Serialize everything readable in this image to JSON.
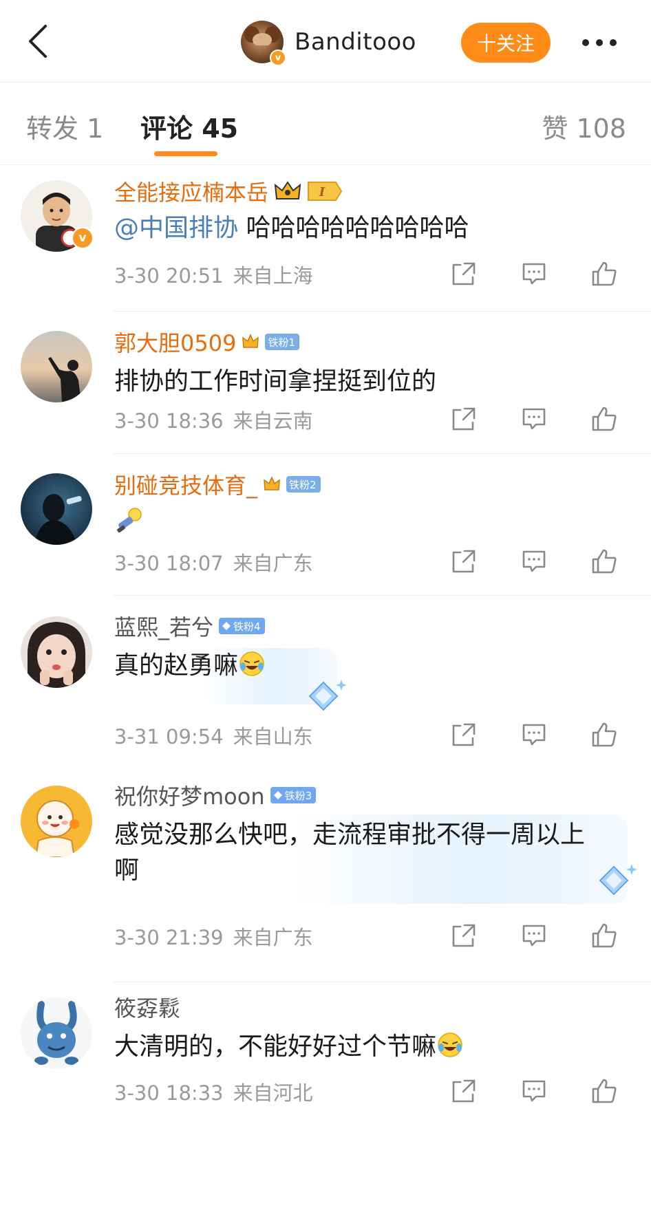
{
  "header": {
    "username": "Banditooo",
    "follow_label": "十关注",
    "verified_mark": "v"
  },
  "tabs": {
    "repost_label": "转发 1",
    "comments_label": "评论 45",
    "likes_label": "赞 108"
  },
  "comments": [
    {
      "name": "全能接应楠本岳",
      "name_color": "#e86c0c",
      "verified": true,
      "level_badge": "I",
      "mention": "@中国排协",
      "text": "哈哈哈哈哈哈哈哈哈",
      "time": "3-30 20:51",
      "location": "来自上海"
    },
    {
      "name": "郭大胆0509",
      "name_color": "#e86c0c",
      "fan_badge": "铁粉1",
      "text": "排协的工作时间拿捏挺到位的",
      "time": "3-30 18:36",
      "location": "来自云南"
    },
    {
      "name": "别碰竞技体育_",
      "name_color": "#e86c0c",
      "fan_badge": "铁粉2",
      "text": "",
      "sticker": "toppled-figure-sticker",
      "time": "3-30 18:07",
      "location": "来自广东"
    },
    {
      "name": "蓝熙_若兮",
      "name_color": "#555555",
      "fan_badge": "铁粉4",
      "text": "真的赵勇嘛",
      "emoji": "laughing-tears-emoji",
      "time": "3-31 09:54",
      "location": "来自山东"
    },
    {
      "name": "祝你好梦moon",
      "name_color": "#555555",
      "fan_badge": "铁粉3",
      "text": "感觉没那么快吧，走流程审批不得一周以上啊",
      "time": "3-30 21:39",
      "location": "来自广东"
    },
    {
      "name": "筱孬鬏",
      "name_color": "#555555",
      "text": "大清明的，不能好好过个节嘛",
      "emoji": "laughing-tears-emoji",
      "time": "3-30 18:33",
      "location": "来自河北"
    }
  ],
  "colors": {
    "accent": "#ff8a16",
    "name_highlight": "#e86c0c",
    "mention": "#4a7fb5",
    "meta": "#9a9a9a",
    "fan_badge": "#6fa8f0"
  },
  "icons": {
    "back": "chevron-left-icon",
    "more": "more-dots-icon",
    "share": "share-icon",
    "reply": "comment-icon",
    "like": "thumbs-up-icon"
  }
}
